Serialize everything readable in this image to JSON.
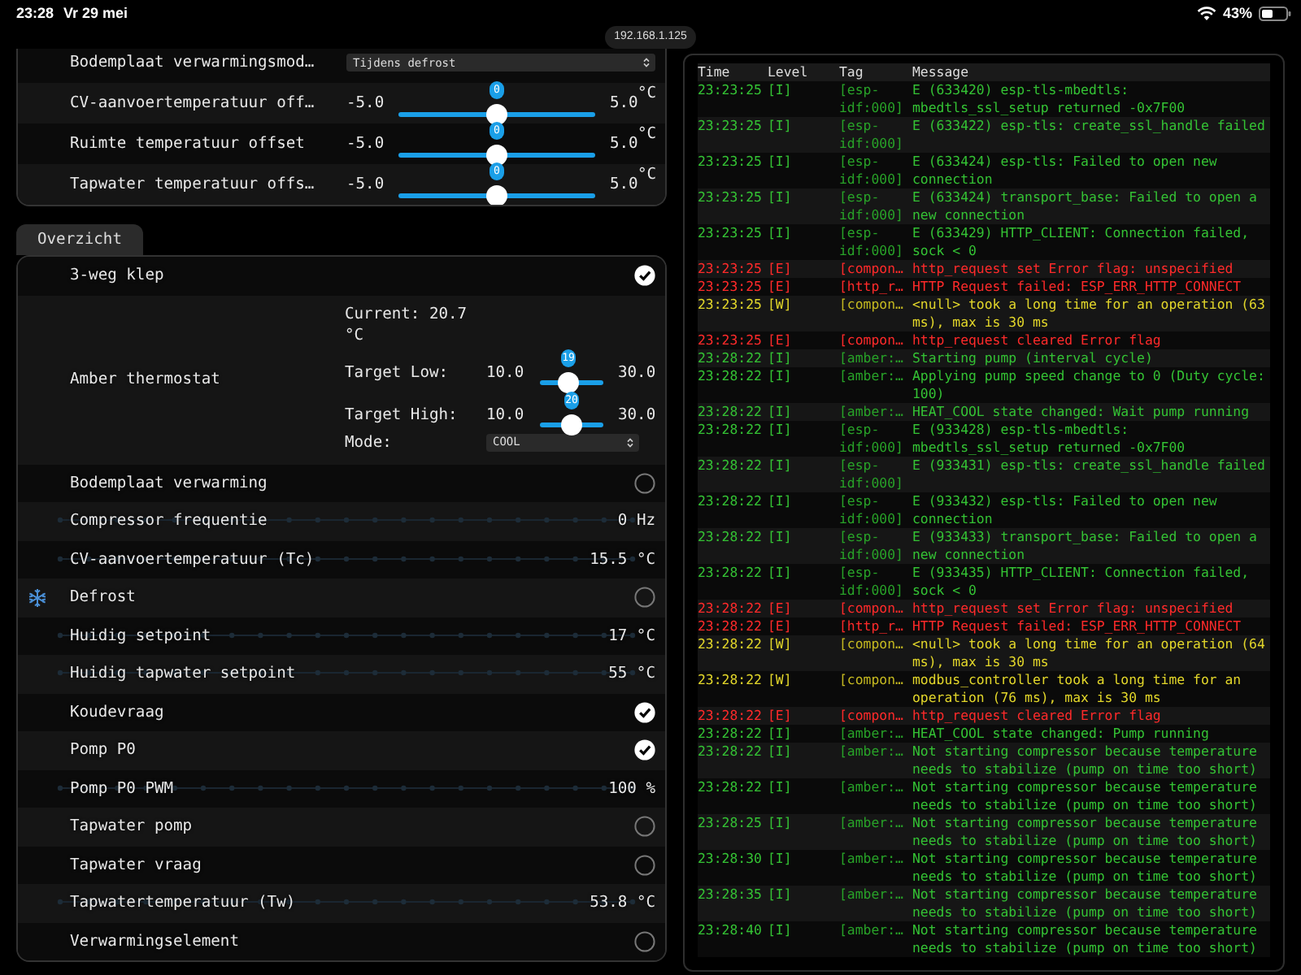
{
  "status_bar": {
    "time": "23:28",
    "date": "Vr 29 mei",
    "battery": "43%"
  },
  "address_bar": {
    "url": "192.168.1.125"
  },
  "settings": [
    {
      "kind": "select",
      "label": "Bodemplaat verwarmingsmod…",
      "value": "Tijdens defrost"
    },
    {
      "kind": "slider",
      "label": "CV-aanvoertemperatuur off…",
      "min": "-5.0",
      "max": "5.0",
      "value": "0",
      "unit": "°C",
      "level": 0.5
    },
    {
      "kind": "slider",
      "label": "Ruimte temperatuur offset",
      "min": "-5.0",
      "max": "5.0",
      "value": "0",
      "unit": "°C",
      "level": 0.5
    },
    {
      "kind": "slider",
      "label": "Tapwater temperatuur offs…",
      "min": "-5.0",
      "max": "5.0",
      "value": "0",
      "unit": "°C",
      "level": 0.5
    }
  ],
  "tab": {
    "label": "Overzicht",
    "selected": true
  },
  "overview": [
    {
      "kind": "switch",
      "label": "3-weg klep",
      "on": true
    },
    {
      "kind": "thermostat",
      "label": "Amber thermostat",
      "current": "Current: 20.7 °C",
      "controls": [
        {
          "label": "Target Low:",
          "min": "10.0",
          "max": "30.0",
          "value": "19",
          "level": 0.45
        },
        {
          "label": "Target High:",
          "min": "10.0",
          "max": "30.0",
          "value": "20",
          "level": 0.5
        }
      ],
      "mode_label": "Mode:",
      "mode": "COOL"
    },
    {
      "kind": "switch",
      "label": "Bodemplaat verwarming",
      "on": false
    },
    {
      "kind": "sensor",
      "label": "Compressor frequentie",
      "value": "0 Hz"
    },
    {
      "kind": "sensor",
      "label": "CV-aanvoertemperatuur (Tc)",
      "value": "15.5 °C"
    },
    {
      "kind": "switch",
      "label": "Defrost",
      "on": false,
      "icon": true
    },
    {
      "kind": "sensor",
      "label": "Huidig setpoint",
      "value": "17 °C"
    },
    {
      "kind": "sensor",
      "label": "Huidig tapwater setpoint",
      "value": "55 °C"
    },
    {
      "kind": "switch",
      "label": "Koudevraag",
      "on": true
    },
    {
      "kind": "switch",
      "label": "Pomp P0",
      "on": true
    },
    {
      "kind": "sensor",
      "label": "Pomp P0 PWM",
      "value": "100 %"
    },
    {
      "kind": "switch",
      "label": "Tapwater pomp",
      "on": false
    },
    {
      "kind": "switch",
      "label": "Tapwater vraag",
      "on": false
    },
    {
      "kind": "sensor",
      "label": "Tapwatertemperatuur (Tw)",
      "value": "53.8 °C"
    },
    {
      "kind": "switch",
      "label": "Verwarmingselement",
      "on": false
    }
  ],
  "log": {
    "columns": [
      "Time",
      "Level",
      "Tag",
      "Message"
    ],
    "rows": [
      {
        "kind": "info",
        "time": "23:23:25",
        "lvl": "[I]",
        "tag": "[esp-idf:000]",
        "message": "E (633420) esp-tls-mbedtls: mbedtls_ssl_setup returned -0x7F00"
      },
      {
        "kind": "info",
        "time": "23:23:25",
        "lvl": "[I]",
        "tag": "[esp-idf:000]",
        "message": "E (633422) esp-tls: create_ssl_handle failed"
      },
      {
        "kind": "info",
        "time": "23:23:25",
        "lvl": "[I]",
        "tag": "[esp-idf:000]",
        "message": "E (633424) esp-tls: Failed to open new connection"
      },
      {
        "kind": "info",
        "time": "23:23:25",
        "lvl": "[I]",
        "tag": "[esp-idf:000]",
        "message": "E (633424) transport_base: Failed to open a new connection"
      },
      {
        "kind": "info",
        "time": "23:23:25",
        "lvl": "[I]",
        "tag": "[esp-idf:000]",
        "message": "E (633429) HTTP_CLIENT: Connection failed, sock < 0"
      },
      {
        "kind": "error",
        "time": "23:23:25",
        "lvl": "[E]",
        "tag": "[compon…",
        "message": "http_request set Error flag: unspecified"
      },
      {
        "kind": "error",
        "time": "23:23:25",
        "lvl": "[E]",
        "tag": "[http_r…",
        "message": "HTTP Request failed: ESP_ERR_HTTP_CONNECT"
      },
      {
        "kind": "warning",
        "time": "23:23:25",
        "lvl": "[W]",
        "tag": "[compon…",
        "message": "<null> took a long time for an operation (63 ms), max is 30 ms"
      },
      {
        "kind": "error",
        "time": "23:23:25",
        "lvl": "[E]",
        "tag": "[compon…",
        "message": "http_request cleared Error flag"
      },
      {
        "kind": "info",
        "time": "23:28:22",
        "lvl": "[I]",
        "tag": "[amber:…",
        "message": "Starting pump (interval cycle)"
      },
      {
        "kind": "info",
        "time": "23:28:22",
        "lvl": "[I]",
        "tag": "[amber:…",
        "message": "Applying pump speed change to 0 (Duty cycle: 100)"
      },
      {
        "kind": "info",
        "time": "23:28:22",
        "lvl": "[I]",
        "tag": "[amber:…",
        "message": "HEAT_COOL state changed: Wait pump running"
      },
      {
        "kind": "info",
        "time": "23:28:22",
        "lvl": "[I]",
        "tag": "[esp-idf:000]",
        "message": "E (933428) esp-tls-mbedtls: mbedtls_ssl_setup returned -0x7F00"
      },
      {
        "kind": "info",
        "time": "23:28:22",
        "lvl": "[I]",
        "tag": "[esp-idf:000]",
        "message": "E (933431) esp-tls: create_ssl_handle failed"
      },
      {
        "kind": "info",
        "time": "23:28:22",
        "lvl": "[I]",
        "tag": "[esp-idf:000]",
        "message": "E (933432) esp-tls: Failed to open new connection"
      },
      {
        "kind": "info",
        "time": "23:28:22",
        "lvl": "[I]",
        "tag": "[esp-idf:000]",
        "message": "E (933433) transport_base: Failed to open a new connection"
      },
      {
        "kind": "info",
        "time": "23:28:22",
        "lvl": "[I]",
        "tag": "[esp-idf:000]",
        "message": "E (933435) HTTP_CLIENT: Connection failed, sock < 0"
      },
      {
        "kind": "error",
        "time": "23:28:22",
        "lvl": "[E]",
        "tag": "[compon…",
        "message": "http_request set Error flag: unspecified"
      },
      {
        "kind": "error",
        "time": "23:28:22",
        "lvl": "[E]",
        "tag": "[http_r…",
        "message": "HTTP Request failed: ESP_ERR_HTTP_CONNECT"
      },
      {
        "kind": "warning",
        "time": "23:28:22",
        "lvl": "[W]",
        "tag": "[compon…",
        "message": "<null> took a long time for an operation (64 ms), max is 30 ms"
      },
      {
        "kind": "warning",
        "time": "23:28:22",
        "lvl": "[W]",
        "tag": "[compon…",
        "message": "modbus_controller took a long time for an operation (76 ms), max is 30 ms"
      },
      {
        "kind": "error",
        "time": "23:28:22",
        "lvl": "[E]",
        "tag": "[compon…",
        "message": "http_request cleared Error flag"
      },
      {
        "kind": "info",
        "time": "23:28:22",
        "lvl": "[I]",
        "tag": "[amber:…",
        "message": "HEAT_COOL state changed: Pump running"
      },
      {
        "kind": "info",
        "time": "23:28:22",
        "lvl": "[I]",
        "tag": "[amber:…",
        "message": "Not starting compressor because temperature needs to stabilize (pump on time too short)"
      },
      {
        "kind": "info",
        "time": "23:28:22",
        "lvl": "[I]",
        "tag": "[amber:…",
        "message": "Not starting compressor because temperature needs to stabilize (pump on time too short)"
      },
      {
        "kind": "info",
        "time": "23:28:25",
        "lvl": "[I]",
        "tag": "[amber:…",
        "message": "Not starting compressor because temperature needs to stabilize (pump on time too short)"
      },
      {
        "kind": "info",
        "time": "23:28:30",
        "lvl": "[I]",
        "tag": "[amber:…",
        "message": "Not starting compressor because temperature needs to stabilize (pump on time too short)"
      },
      {
        "kind": "info",
        "time": "23:28:35",
        "lvl": "[I]",
        "tag": "[amber:…",
        "message": "Not starting compressor because temperature needs to stabilize (pump on time too short)"
      },
      {
        "kind": "info",
        "time": "23:28:40",
        "lvl": "[I]",
        "tag": "[amber:…",
        "message": "Not starting compressor because temperature needs to stabilize (pump on time too short)"
      }
    ]
  }
}
